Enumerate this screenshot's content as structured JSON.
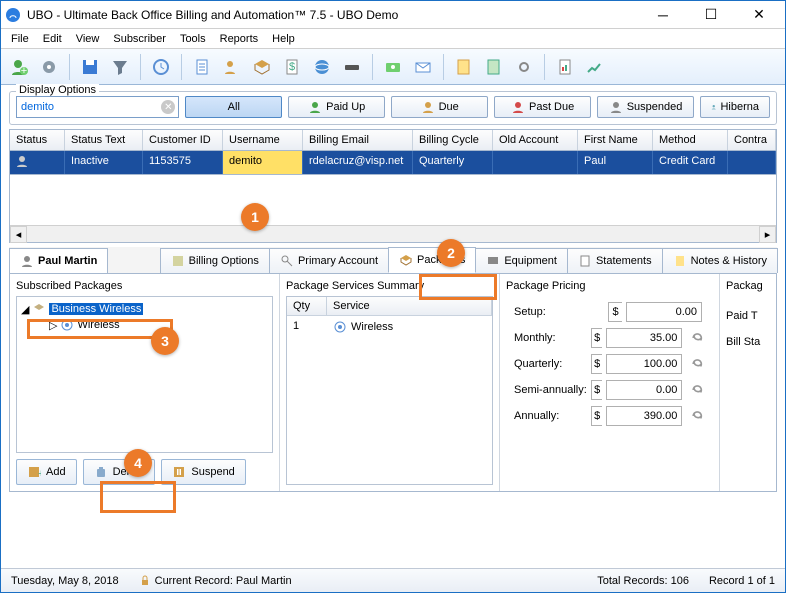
{
  "window": {
    "title": "UBO - Ultimate Back Office Billing and Automation™ 7.5 - UBO Demo"
  },
  "menu": [
    "File",
    "Edit",
    "View",
    "Subscriber",
    "Tools",
    "Reports",
    "Help"
  ],
  "displayOptions": {
    "legend": "Display Options",
    "search": "demito",
    "filters": [
      "All",
      "Paid Up",
      "Due",
      "Past Due",
      "Suspended",
      "Hiberna"
    ]
  },
  "grid": {
    "headers": [
      "Status",
      "Status Text",
      "Customer ID",
      "Username",
      "Billing Email",
      "Billing Cycle",
      "Old Account",
      "First Name",
      "Method",
      "Contra"
    ],
    "row": {
      "status": "",
      "statusText": "Inactive",
      "custId": "1153575",
      "username": "demito",
      "email": "rdelacruz@visp.net",
      "cycle": "Quarterly",
      "oldAcct": "",
      "first": "Paul",
      "method": "Credit Card",
      "contra": ""
    }
  },
  "subscriber": {
    "name": "Paul Martin"
  },
  "tabs": [
    "Billing Options",
    "Primary Account",
    "Packages",
    "Equipment",
    "Statements",
    "Notes & History"
  ],
  "subscribed": {
    "title": "Subscribed Packages",
    "root": "Business Wireless",
    "child": "Wireless",
    "buttons": {
      "add": "Add",
      "del": "Delete",
      "sus": "Suspend"
    }
  },
  "summary": {
    "title": "Package Services Summary",
    "headers": [
      "Qty",
      "Service"
    ],
    "row": {
      "qty": "1",
      "svc": "Wireless"
    }
  },
  "pricing": {
    "title": "Package Pricing",
    "rows": [
      {
        "label": "Setup:",
        "val": "0.00"
      },
      {
        "label": "Monthly:",
        "val": "35.00"
      },
      {
        "label": "Quarterly:",
        "val": "100.00"
      },
      {
        "label": "Semi-annually:",
        "val": "0.00"
      },
      {
        "label": "Annually:",
        "val": "390.00"
      }
    ]
  },
  "right": {
    "pkg": "Packag",
    "paid": "Paid T",
    "bill": "Bill Sta"
  },
  "status": {
    "date": "Tuesday, May 8, 2018",
    "current": "Current Record: Paul Martin",
    "total": "Total Records:  106",
    "rec": "Record 1 of 1"
  },
  "callouts": [
    "1",
    "2",
    "3",
    "4"
  ]
}
